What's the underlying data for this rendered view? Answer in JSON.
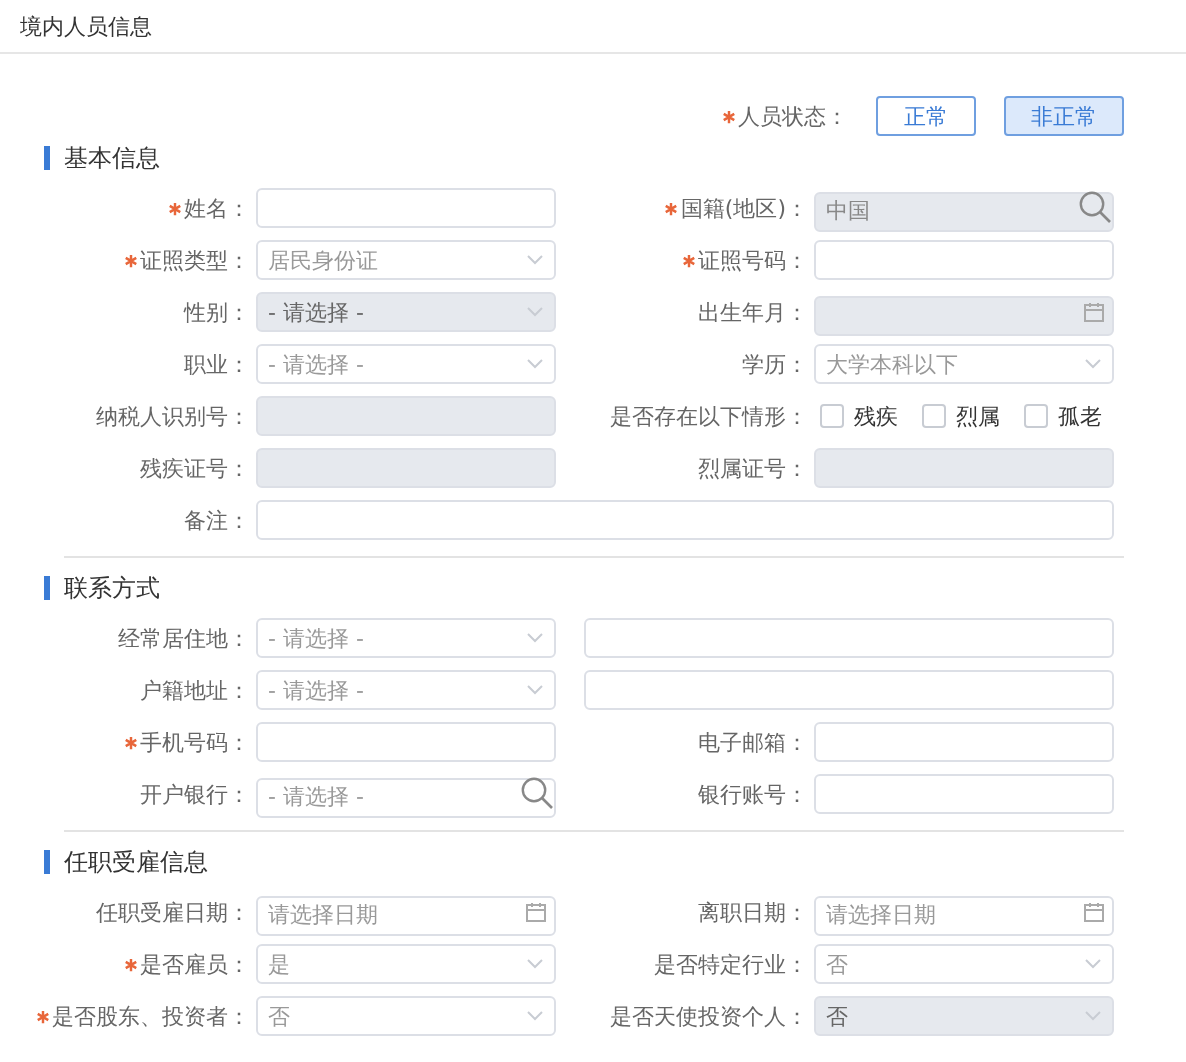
{
  "dialog": {
    "title": "境内人员信息"
  },
  "status": {
    "label": "人员状态：",
    "required": true,
    "options": [
      {
        "label": "正常",
        "selected": false
      },
      {
        "label": "非正常",
        "selected": true
      }
    ]
  },
  "sections": [
    {
      "title": "基本信息",
      "rows": [
        [
          {
            "label": "姓名：",
            "required": true,
            "disabled": false,
            "kind": "text"
          },
          {
            "label": "国籍(地区)：",
            "required": true,
            "disabled": true,
            "kind": "search",
            "value": "中国"
          }
        ],
        [
          {
            "label": "证照类型：",
            "required": true,
            "disabled": false,
            "kind": "select",
            "value": "居民身份证"
          },
          {
            "label": "证照号码：",
            "required": true,
            "disabled": false,
            "kind": "text"
          }
        ],
        [
          {
            "label": "性别：",
            "required": false,
            "disabled": true,
            "kind": "select",
            "value": "- 请选择 -"
          },
          {
            "label": "出生年月：",
            "required": false,
            "disabled": true,
            "kind": "date"
          }
        ],
        [
          {
            "label": "职业：",
            "required": false,
            "disabled": false,
            "kind": "select",
            "value": "- 请选择 -"
          },
          {
            "label": "学历：",
            "required": false,
            "disabled": false,
            "kind": "select",
            "value": "大学本科以下"
          }
        ],
        [
          {
            "label": "纳税人识别号：",
            "required": false,
            "disabled": true,
            "kind": "text"
          },
          {
            "label": "是否存在以下情形：",
            "required": false,
            "disabled": false,
            "kind": "checks",
            "options": [
              {
                "label": "残疾",
                "checked": false
              },
              {
                "label": "烈属",
                "checked": false
              },
              {
                "label": "孤老",
                "checked": false
              }
            ]
          }
        ],
        [
          {
            "label": "残疾证号：",
            "required": false,
            "disabled": true,
            "kind": "text"
          },
          {
            "label": "烈属证号：",
            "required": false,
            "disabled": true,
            "kind": "text"
          }
        ],
        [
          {
            "label": "备注：",
            "required": false,
            "disabled": false,
            "kind": "wide"
          }
        ]
      ]
    },
    {
      "title": "联系方式",
      "rows": [
        [
          {
            "label": "经常居住地：",
            "required": false,
            "disabled": false,
            "kind": "address",
            "value": "- 请选择 -"
          }
        ],
        [
          {
            "label": "户籍地址：",
            "required": false,
            "disabled": false,
            "kind": "address",
            "value": "- 请选择 -"
          }
        ],
        [
          {
            "label": "手机号码：",
            "required": true,
            "disabled": false,
            "kind": "text"
          },
          {
            "label": "电子邮箱：",
            "required": false,
            "disabled": false,
            "kind": "text"
          }
        ],
        [
          {
            "label": "开户银行：",
            "required": false,
            "disabled": false,
            "kind": "search",
            "placeholder": "- 请选择 -"
          },
          {
            "label": "银行账号：",
            "required": false,
            "disabled": false,
            "kind": "text"
          }
        ]
      ]
    },
    {
      "title": "任职受雇信息",
      "rows": [
        [
          {
            "label": "任职受雇日期：",
            "required": false,
            "disabled": false,
            "kind": "date",
            "placeholder": "请选择日期"
          },
          {
            "label": "离职日期：",
            "required": false,
            "disabled": false,
            "kind": "date",
            "placeholder": "请选择日期"
          }
        ],
        [
          {
            "label": "是否雇员：",
            "required": true,
            "disabled": false,
            "kind": "select",
            "value": "是"
          },
          {
            "label": "是否特定行业：",
            "required": false,
            "disabled": false,
            "kind": "select",
            "value": "否"
          }
        ],
        [
          {
            "label": "是否股东、投资者：",
            "required": true,
            "disabled": false,
            "kind": "select",
            "value": "否"
          },
          {
            "label": "是否天使投资个人：",
            "required": false,
            "disabled": true,
            "kind": "select",
            "value": "否"
          }
        ]
      ]
    }
  ]
}
